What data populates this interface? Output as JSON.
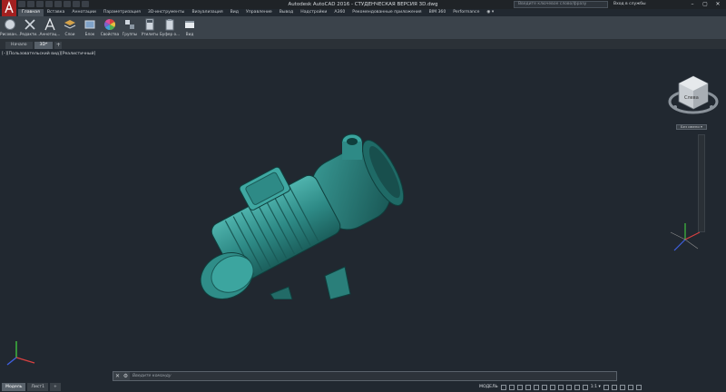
{
  "title": "Autodesk AutoCAD 2016 - СТУДЕНЧЕСКАЯ ВЕРСИЯ    3D.dwg",
  "search_placeholder": "Введите ключевое слово/фразу",
  "signin_label": "Вход в службы",
  "window_controls": [
    "–",
    "▢",
    "✕"
  ],
  "ribbon_tabs": [
    "Главная",
    "Вставка",
    "Аннотации",
    "Параметризация",
    "3D-инструменты",
    "Визуализация",
    "Вид",
    "Управление",
    "Вывод",
    "Надстройки",
    "A360",
    "Рекомендованные приложения",
    "BIM 360",
    "Performance",
    "◉ ▾"
  ],
  "ribbon_panels": [
    {
      "label": "Рисован...",
      "icon": "draw-icon"
    },
    {
      "label": "Редакти...",
      "icon": "modify-icon"
    },
    {
      "label": "Аннотац...",
      "icon": "annotation-icon"
    },
    {
      "label": "Слои",
      "icon": "layers-icon"
    },
    {
      "label": "Блок",
      "icon": "block-icon"
    },
    {
      "label": "Свойства",
      "icon": "properties-icon"
    },
    {
      "label": "Группы",
      "icon": "groups-icon"
    },
    {
      "label": "Утилиты",
      "icon": "utilities-icon"
    },
    {
      "label": "Буфер о...",
      "icon": "clipboard-icon"
    },
    {
      "label": "Вид",
      "icon": "view-icon"
    }
  ],
  "file_tabs": [
    "Начало",
    "3D*"
  ],
  "viewport_label": "[–][Пользовательский вид][Реалистичный]",
  "nav_label": "Без имени ▾",
  "viewcube_face": "Слева",
  "command_placeholder": "Введите команду",
  "command_buttons": [
    "✕",
    "🔧"
  ],
  "layout_tabs": [
    "Модель",
    "Лист1",
    "+"
  ],
  "status": {
    "model": "МОДЕЛЬ",
    "scale": "1:1 ▾"
  },
  "colors": {
    "accent": "#cc2a2a",
    "motor": "#2e8a86",
    "background": "#212830"
  }
}
